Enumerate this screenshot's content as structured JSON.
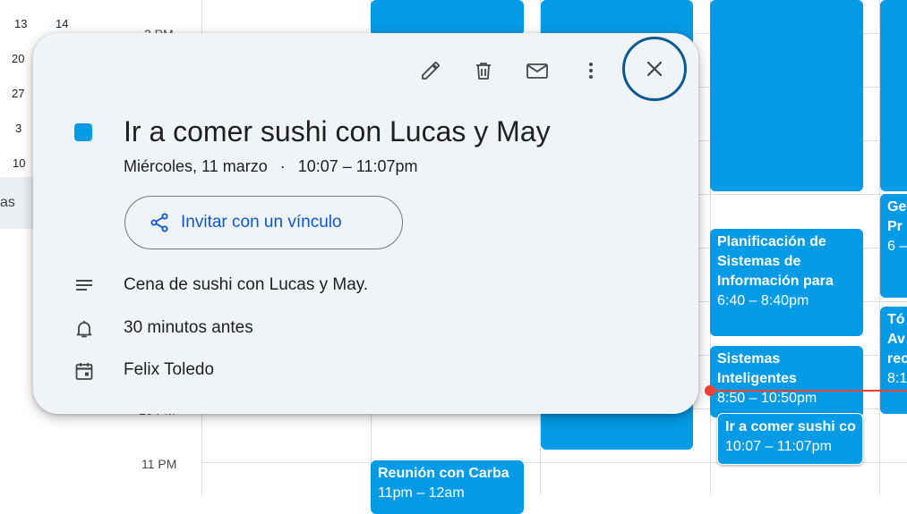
{
  "mini_calendar": {
    "rows": [
      [
        "13",
        "14"
      ],
      [
        "20",
        ""
      ],
      [
        "27",
        ""
      ],
      [
        "3",
        ""
      ],
      [
        "10",
        ""
      ]
    ],
    "partial_label": "as"
  },
  "grid": {
    "hour_labels": {
      "top": "3 PM",
      "mid": "10 PM",
      "eleven": "11 PM"
    }
  },
  "events": {
    "planificacion": {
      "title": "Planificación de Sistemas de Información para",
      "time": "6:40 – 8:40pm"
    },
    "sistemas": {
      "title": "Sistemas Inteligentes",
      "time": "8:50 – 10:50pm"
    },
    "sushi_chip": {
      "title": "Ir a comer sushi co",
      "time": "10:07 – 11:07pm"
    },
    "reunion": {
      "title": "Reunión con Carba",
      "time": "11pm – 12am"
    },
    "ge": {
      "title": "Ge Pr",
      "time": "6 –"
    },
    "to": {
      "title": "Tó Av rec",
      "time": "8:1"
    }
  },
  "popup": {
    "toolbar": {
      "edit_icon": "pencil-icon",
      "delete_icon": "trash-icon",
      "email_icon": "mail-icon",
      "more_icon": "more-vertical-icon",
      "close_icon": "close-icon"
    },
    "event_color": "#039be5",
    "title": "Ir a comer sushi con Lucas y May",
    "date": "Miércoles, 11 marzo",
    "separator": "·",
    "time_range": "10:07 – 11:07pm",
    "invite_label": "Invitar con un vínculo",
    "description": "Cena de sushi con Lucas y May.",
    "reminder": "30 minutos antes",
    "calendar_owner": "Felix Toledo"
  },
  "colors": {
    "accent": "#039be5",
    "link": "#0b57d0",
    "now_line": "#ea4335",
    "popup_bg": "#f0f4f9"
  }
}
